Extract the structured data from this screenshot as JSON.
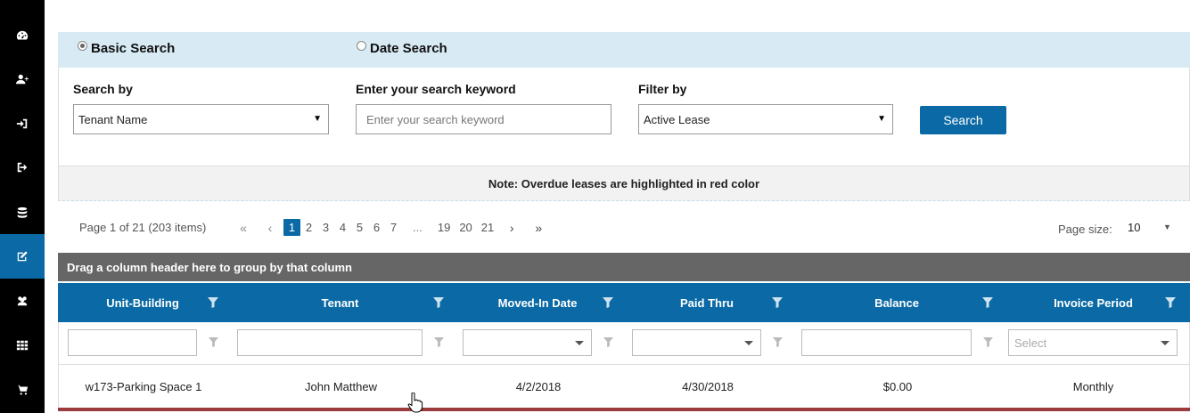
{
  "sidebar": {
    "items": [
      {
        "icon": "dashboard-icon"
      },
      {
        "icon": "add-user-icon"
      },
      {
        "icon": "sign-in-icon"
      },
      {
        "icon": "sign-out-icon"
      },
      {
        "icon": "database-icon"
      },
      {
        "icon": "edit-icon",
        "active": true
      },
      {
        "icon": "users-icon"
      },
      {
        "icon": "grid-icon"
      },
      {
        "icon": "cart-icon"
      }
    ]
  },
  "search_mode": {
    "basic_label": "Basic Search",
    "date_label": "Date Search",
    "selected": "basic"
  },
  "search_form": {
    "search_by_label": "Search by",
    "search_by_value": "Tenant Name",
    "keyword_label": "Enter your search keyword",
    "keyword_placeholder": "Enter your search keyword",
    "filter_label": "Filter by",
    "filter_value": "Active Lease",
    "search_button": "Search"
  },
  "note": "Note: Overdue leases are highlighted in red color",
  "pager": {
    "info": "Page 1 of 21 (203 items)",
    "pages": [
      "1",
      "2",
      "3",
      "4",
      "5",
      "6",
      "7"
    ],
    "ellipsis": "...",
    "last_pages": [
      "19",
      "20",
      "21"
    ],
    "current": "1",
    "page_size_label": "Page size:",
    "page_size_value": "10"
  },
  "grid": {
    "group_hint": "Drag a column header here to group by that column",
    "columns": [
      "Unit-Building",
      "Tenant",
      "Moved-In Date",
      "Paid Thru",
      "Balance",
      "Invoice Period"
    ],
    "invoice_filter_placeholder": "Select",
    "rows": [
      [
        "w173-Parking Space 1",
        "John Matthew",
        "4/2/2018",
        "4/30/2018",
        "$0.00",
        "Monthly"
      ]
    ]
  },
  "colors": {
    "accent": "#0b6aa5",
    "sidebar": "#000000",
    "group_bar": "#666666",
    "search_mode_bg": "#d8ebf5",
    "overdue": "#9c3b3b"
  }
}
